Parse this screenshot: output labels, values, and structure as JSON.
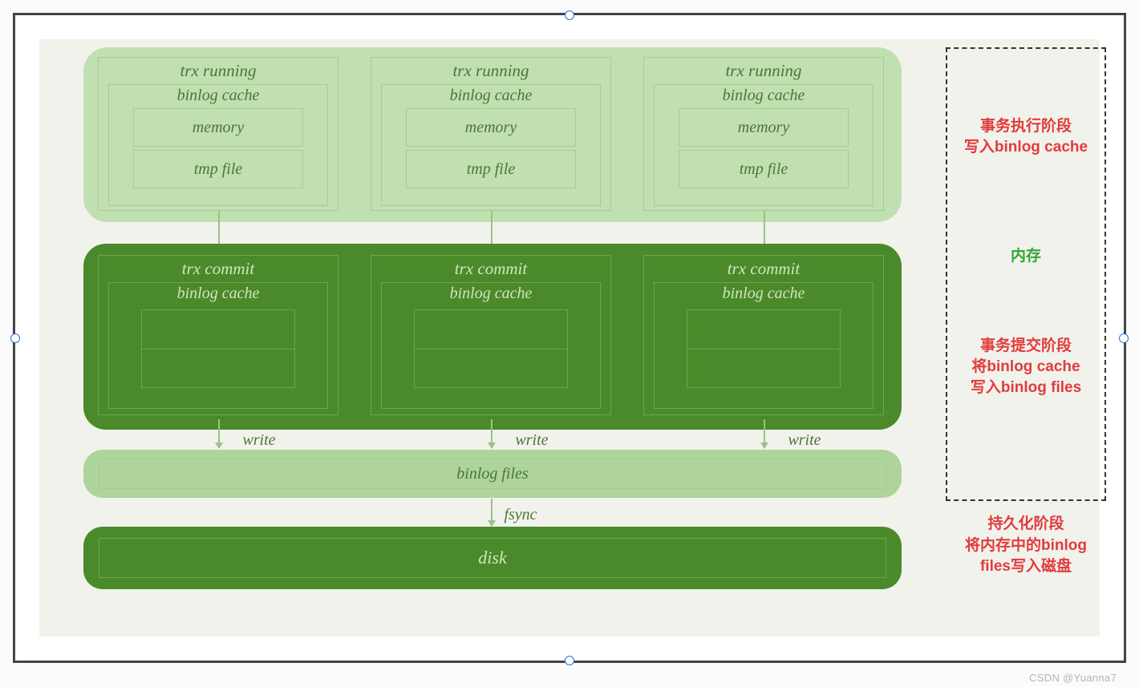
{
  "trx_running": {
    "label": "trx running",
    "binlog_label": "binlog cache",
    "memory": "memory",
    "tmpfile": "tmp file"
  },
  "trx_commit": {
    "label": "trx commit",
    "binlog_label": "binlog cache"
  },
  "write_label": "write",
  "binlog_files": "binlog files",
  "fsync_label": "fsync",
  "disk_label": "disk",
  "annotations": {
    "exec1": "事务执行阶段",
    "exec2": "写入binlog cache",
    "memory": "内存",
    "commit1": "事务提交阶段",
    "commit2": "将binlog cache",
    "commit3": "写入binlog files",
    "persist1": "持久化阶段",
    "persist2": "将内存中的binlog",
    "persist3": "files写入磁盘"
  },
  "watermark": "CSDN @Yuanna7",
  "positions": {
    "columns_x": [
      60,
      400,
      740
    ]
  }
}
